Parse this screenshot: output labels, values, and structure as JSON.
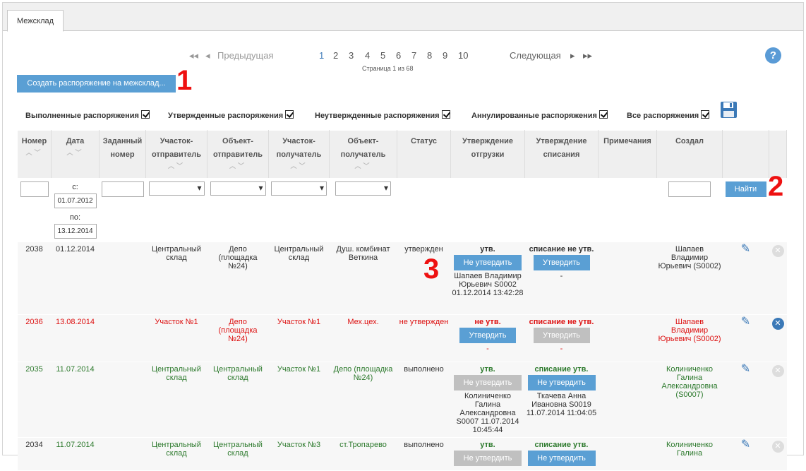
{
  "tab": {
    "label": "Межсклад"
  },
  "pager": {
    "prev": "Предыдущая",
    "next": "Следующая",
    "pages": [
      "1",
      "2",
      "3",
      "4",
      "5",
      "6",
      "7",
      "8",
      "9",
      "10"
    ],
    "counter": "Страница 1 из 68"
  },
  "help": "?",
  "create_button": "Создать распоряжение на межсклад...",
  "marks": {
    "m1": "1",
    "m2": "2",
    "m3": "3"
  },
  "filters": {
    "done": "Выполненные распоряжения",
    "approved": "Утвержденные распоряжения",
    "not_approved": "Неутвержденные распоряжения",
    "cancelled": "Аннулированные распоряжения",
    "all": "Все распоряжения"
  },
  "headers": {
    "number": "Номер",
    "date": "Дата",
    "given_number": "Заданный номер",
    "sender_site": "Участок-отправитель",
    "sender_object": "Объект-отправитель",
    "receiver_site": "Участок-получатель",
    "receiver_object": "Объект-получатель",
    "status": "Статус",
    "approve_shipment": "Утверждение отгрузки",
    "approve_writeoff": "Утверждение списания",
    "notes": "Примечания",
    "creator": "Создал"
  },
  "filter_row": {
    "from_label": "с:",
    "from_value": "01.07.2012",
    "to_label": "по:",
    "to_value": "13.12.2014",
    "find_button": "Найти"
  },
  "rows": [
    {
      "number": "2038",
      "date": "01.12.2014",
      "sender_site": "Центральный склад",
      "sender_object": "Депо (площадка №24)",
      "receiver_site": "Центральный склад",
      "receiver_object": "Душ. комбинат Веткина",
      "status": "утвержден",
      "ship_state": "утв.",
      "ship_button": "Не утвердить",
      "ship_info": "Шапаев Владимир Юрьевич S0002 01.12.2014 13:42:28",
      "wo_state": "списание не утв.",
      "wo_button": "Утвердить",
      "wo_info": "-",
      "creator": "Шапаев Владимир Юрьевич (S0002)"
    },
    {
      "number": "2036",
      "date": "13.08.2014",
      "sender_site": "Участок №1",
      "sender_object": "Депо (площадка №24)",
      "receiver_site": "Участок №1",
      "receiver_object": "Мех.цех.",
      "status": "не утвержден",
      "ship_state": "не утв.",
      "ship_button": "Утвердить",
      "ship_info": "-",
      "wo_state": "списание не утв.",
      "wo_button": "Утвердить",
      "wo_info": "-",
      "creator": "Шапаев Владимир Юрьевич (S0002)"
    },
    {
      "number": "2035",
      "date": "11.07.2014",
      "sender_site": "Центральный склад",
      "sender_object": "Центральный склад",
      "receiver_site": "Участок №1",
      "receiver_object": "Депо (площадка №24)",
      "status": "выполнено",
      "ship_state": "утв.",
      "ship_button": "Не утвердить",
      "ship_info": "Колиниченко Галина Александровна S0007 11.07.2014 10:45:44",
      "wo_state": "списание утв.",
      "wo_button": "Не утвердить",
      "wo_info": "Ткачева Анна Ивановна S0019 11.07.2014 11:04:05",
      "creator": "Колиниченко Галина Александровна (S0007)"
    },
    {
      "number": "2034",
      "date": "11.07.2014",
      "sender_site": "Центральный склад",
      "sender_object": "Центральный склад",
      "receiver_site": "Участок №3",
      "receiver_object": "ст.Тропарево",
      "status": "выполнено",
      "ship_state": "утв.",
      "ship_button": "Не утвердить",
      "wo_state": "списание утв.",
      "wo_button": "Не утвердить",
      "creator": "Колиниченко Галина"
    }
  ],
  "colors": {
    "accent": "#5a9fd4",
    "red": "#dd1111",
    "green": "#2d7a2d"
  }
}
